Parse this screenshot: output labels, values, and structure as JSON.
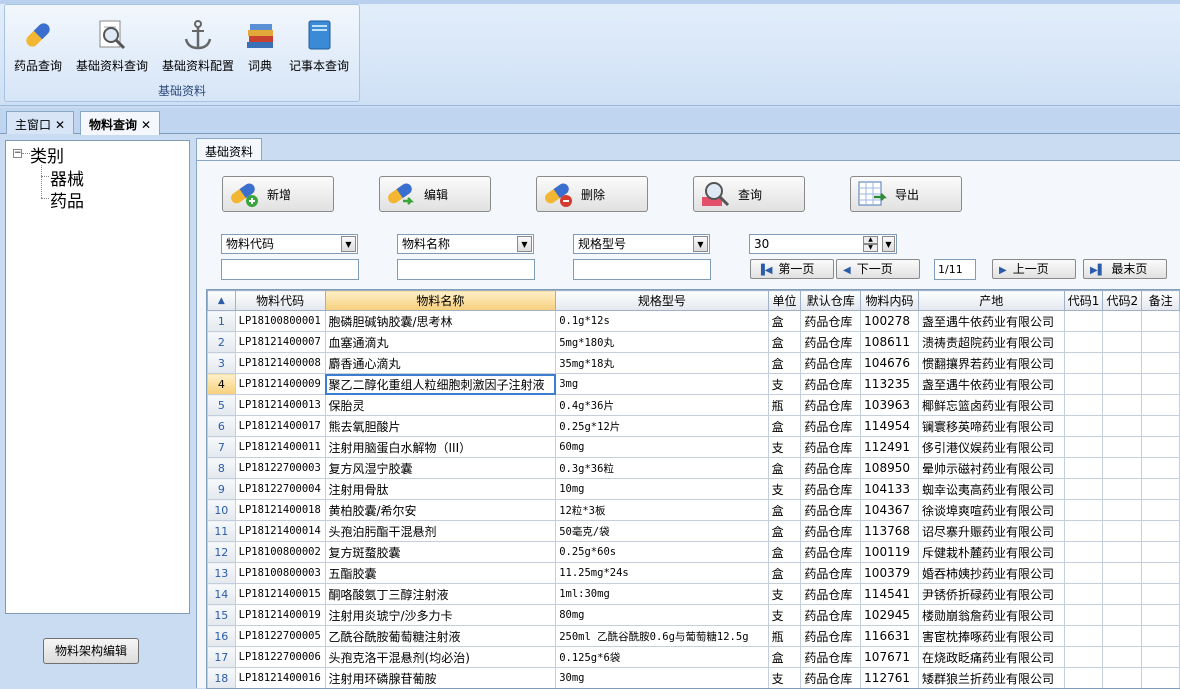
{
  "ribbon": {
    "buttons": [
      {
        "label": "药品查询",
        "icon": "capsule-icon"
      },
      {
        "label": "基础资料查询",
        "icon": "magnifier-document-icon"
      },
      {
        "label": "基础资料配置",
        "icon": "anchor-icon"
      },
      {
        "label": "词典",
        "icon": "books-icon"
      },
      {
        "label": "记事本查询",
        "icon": "notebook-icon"
      }
    ],
    "group_label": "基础资料"
  },
  "doc_tabs": [
    {
      "label": "主窗口",
      "close": "✕"
    },
    {
      "label": "物料查询",
      "close": "✕"
    }
  ],
  "tree": {
    "toggle": "−",
    "root": "类别",
    "children": [
      "器械",
      "药品"
    ]
  },
  "left_button": "物料架构编辑",
  "inner_tab": "基础资料",
  "toolbar": {
    "add": "新增",
    "edit": "编辑",
    "delete": "删除",
    "query": "查询",
    "export": "导出"
  },
  "filters": [
    {
      "field": "物料代码",
      "value": ""
    },
    {
      "field": "物料名称",
      "value": ""
    },
    {
      "field": "规格型号",
      "value": ""
    }
  ],
  "page_size": "30",
  "pager": {
    "first": "第一页",
    "next": "下一页",
    "page_info": "1/11",
    "prev": "上一页",
    "last": "最末页"
  },
  "grid": {
    "columns": [
      "物料代码",
      "物料名称",
      "规格型号",
      "单位",
      "默认仓库",
      "物料内码",
      "产地",
      "代码1",
      "代码2",
      "备注"
    ],
    "sorted_column": "物料名称",
    "current_row": 4,
    "rows": [
      [
        "LP18100800001",
        "胞磷胆碱钠胶囊/思考林",
        "0.1g*12s",
        "盒",
        "药品仓库",
        "100278",
        "盏至遇牛依药业有限公司",
        "",
        "",
        ""
      ],
      [
        "LP18121400007",
        "血塞通滴丸",
        "5mg*180丸",
        "盒",
        "药品仓库",
        "108611",
        "溃祷责超院药业有限公司",
        "",
        "",
        ""
      ],
      [
        "LP18121400008",
        "麝香通心滴丸",
        "35mg*18丸",
        "盒",
        "药品仓库",
        "104676",
        "惯翻攘界若药业有限公司",
        "",
        "",
        ""
      ],
      [
        "LP18121400009",
        "聚乙二醇化重组人粒细胞刺激因子注射液",
        "3mg",
        "支",
        "药品仓库",
        "113235",
        "盏至遇牛依药业有限公司",
        "",
        "",
        ""
      ],
      [
        "LP18121400013",
        "保胎灵",
        "0.4g*36片",
        "瓶",
        "药品仓库",
        "103963",
        "椰鲜忘篮卤药业有限公司",
        "",
        "",
        ""
      ],
      [
        "LP18121400017",
        "熊去氧胆酸片",
        "0.25g*12片",
        "盒",
        "药品仓库",
        "114954",
        "镧寰移英啼药业有限公司",
        "",
        "",
        ""
      ],
      [
        "LP18121400011",
        "注射用脑蛋白水解物（III）",
        "60mg",
        "支",
        "药品仓库",
        "112491",
        "侈引港仪娱药业有限公司",
        "",
        "",
        ""
      ],
      [
        "LP18122700003",
        "复方风湿宁胶囊",
        "0.3g*36粒",
        "盒",
        "药品仓库",
        "108950",
        "晕帅示磁衬药业有限公司",
        "",
        "",
        ""
      ],
      [
        "LP18122700004",
        "注射用骨肽",
        "10mg",
        "支",
        "药品仓库",
        "104133",
        "蜘幸讼夷高药业有限公司",
        "",
        "",
        ""
      ],
      [
        "LP18121400018",
        "黄柏胶囊/希尔安",
        "12粒*3板",
        "盒",
        "药品仓库",
        "104367",
        "徐谈埠爽喧药业有限公司",
        "",
        "",
        ""
      ],
      [
        "LP18121400014",
        "头孢泊肟酯干混悬剂",
        "50毫克/袋",
        "盒",
        "药品仓库",
        "113768",
        "诏尽寨升赈药业有限公司",
        "",
        "",
        ""
      ],
      [
        "LP18100800002",
        "复方斑蝥胶囊",
        "0.25g*60s",
        "盒",
        "药品仓库",
        "100119",
        "斥健栽朴麓药业有限公司",
        "",
        "",
        ""
      ],
      [
        "LP18100800003",
        "五酯胶囊",
        "11.25mg*24s",
        "盒",
        "药品仓库",
        "100379",
        "婚吞柿姨抄药业有限公司",
        "",
        "",
        ""
      ],
      [
        "LP18121400015",
        "酮咯酸氨丁三醇注射液",
        "1ml:30mg",
        "支",
        "药品仓库",
        "114541",
        "尹锈侨折碌药业有限公司",
        "",
        "",
        ""
      ],
      [
        "LP18121400019",
        "注射用炎琥宁/沙多力卡",
        "80mg",
        "支",
        "药品仓库",
        "102945",
        "楼勋崩翁詹药业有限公司",
        "",
        "",
        ""
      ],
      [
        "LP18122700005",
        "乙酰谷酰胺葡萄糖注射液",
        "250ml 乙酰谷酰胺0.6g与葡萄糖12.5g",
        "瓶",
        "药品仓库",
        "116631",
        "害宦枕捧啄药业有限公司",
        "",
        "",
        ""
      ],
      [
        "LP18122700006",
        "头孢克洛干混悬剂(均必治)",
        "0.125g*6袋",
        "盒",
        "药品仓库",
        "107671",
        "在烧政眨痛药业有限公司",
        "",
        "",
        ""
      ],
      [
        "LP18121400016",
        "注射用环磷腺苷葡胺",
        "30mg",
        "支",
        "药品仓库",
        "112761",
        "矮群狼兰折药业有限公司",
        "",
        "",
        ""
      ]
    ]
  }
}
